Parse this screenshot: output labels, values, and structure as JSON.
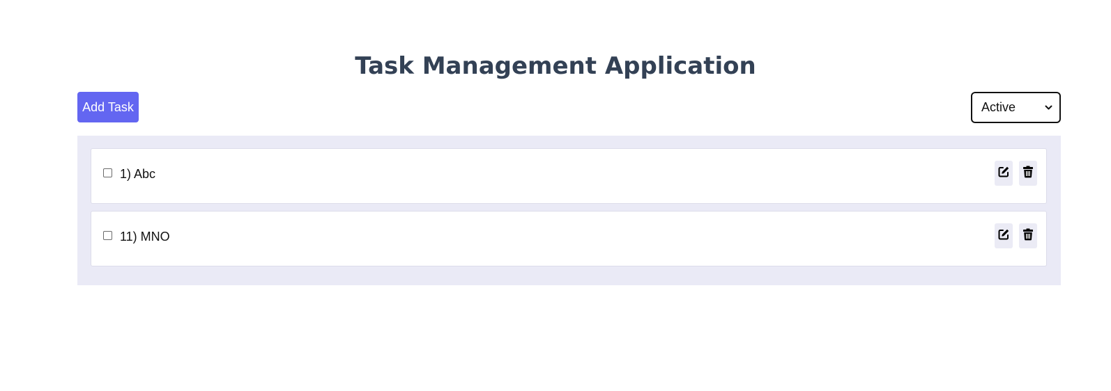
{
  "header": {
    "title": "Task Management Application"
  },
  "toolbar": {
    "add_task_label": "Add Task",
    "filter": {
      "selected": "Active"
    }
  },
  "tasks": [
    {
      "label": "1) Abc",
      "checked": false
    },
    {
      "label": "11) MNO",
      "checked": false
    }
  ],
  "icons": {
    "edit": "edit-icon",
    "delete": "trash-icon",
    "dropdown": "chevron-down-icon"
  },
  "colors": {
    "accent": "#6366f1",
    "title": "#334155",
    "panel_bg": "#eaeaf6",
    "icon_button_bg": "#ebebf5"
  }
}
